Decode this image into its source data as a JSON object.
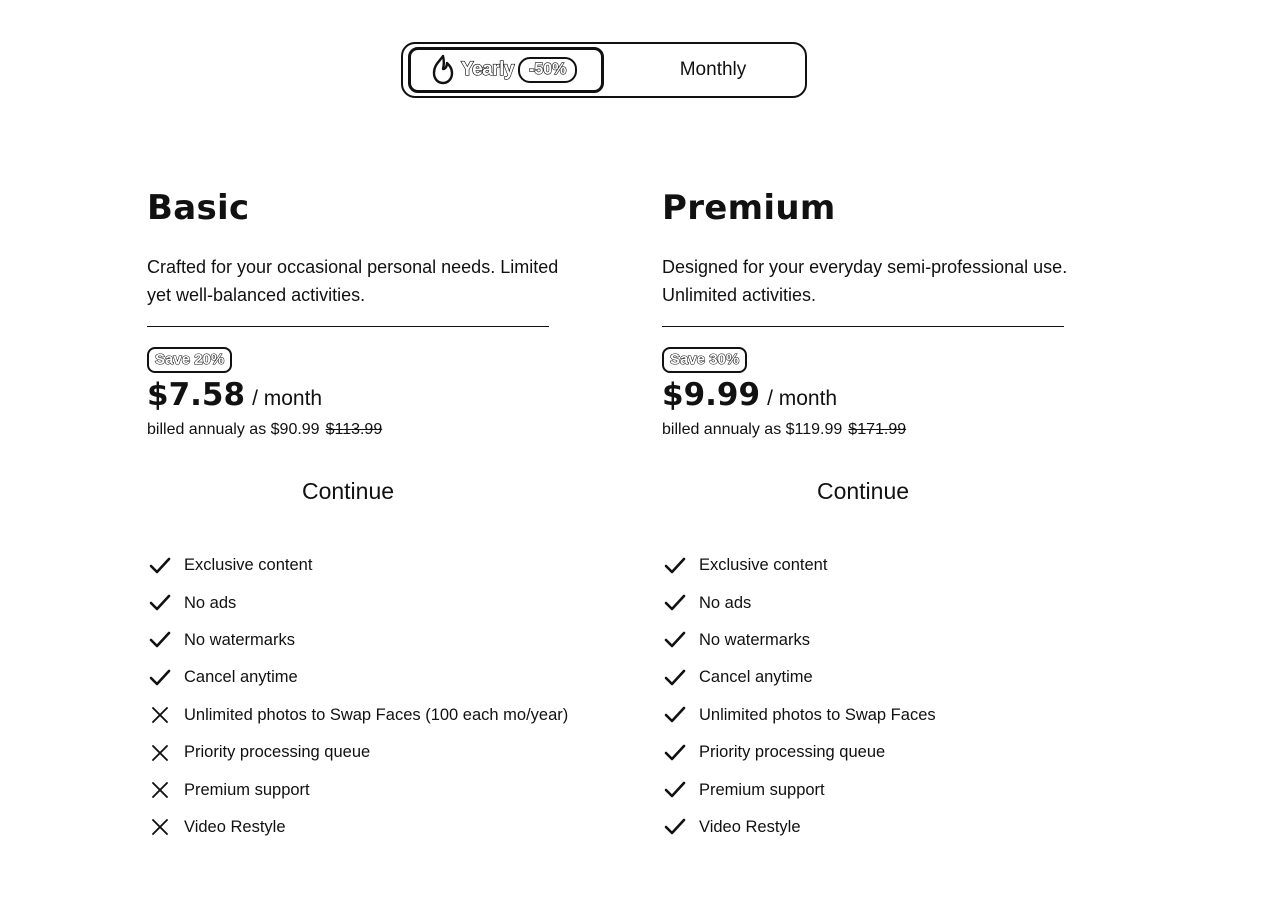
{
  "billing_toggle": {
    "yearly_label": "Yearly",
    "yearly_discount": "-50%",
    "monthly_label": "Monthly",
    "selected": "Yearly"
  },
  "plans": [
    {
      "name": "Basic",
      "description": "Crafted for your occasional personal needs. Limited yet well-balanced activities.",
      "save_badge": "Save 20%",
      "price": "$7.58",
      "per": "/ month",
      "billed_text": "billed annualy as $90.99",
      "old_price": "$113.99",
      "cta": "Continue",
      "features": [
        {
          "label": "Exclusive content",
          "included": true
        },
        {
          "label": "No ads",
          "included": true
        },
        {
          "label": "No watermarks",
          "included": true
        },
        {
          "label": "Cancel anytime",
          "included": true
        },
        {
          "label": "Unlimited photos to Swap Faces (100 each mo/year)",
          "included": false
        },
        {
          "label": "Priority processing queue",
          "included": false
        },
        {
          "label": "Premium support",
          "included": false
        },
        {
          "label": "Video Restyle",
          "included": false
        }
      ]
    },
    {
      "name": "Premium",
      "description": "Designed for your everyday semi-professional use. Unlimited activities.",
      "save_badge": "Save 30%",
      "price": "$9.99",
      "per": "/ month",
      "billed_text": "billed annualy as $119.99",
      "old_price": "$171.99",
      "cta": "Continue",
      "features": [
        {
          "label": "Exclusive content",
          "included": true
        },
        {
          "label": "No ads",
          "included": true
        },
        {
          "label": "No watermarks",
          "included": true
        },
        {
          "label": "Cancel anytime",
          "included": true
        },
        {
          "label": "Unlimited photos to Swap Faces",
          "included": true
        },
        {
          "label": "Priority processing queue",
          "included": true
        },
        {
          "label": "Premium support",
          "included": true
        },
        {
          "label": "Video Restyle",
          "included": true
        }
      ]
    }
  ],
  "icons": {
    "included": "check-icon",
    "excluded": "x-icon",
    "yearly": "fire-icon"
  }
}
